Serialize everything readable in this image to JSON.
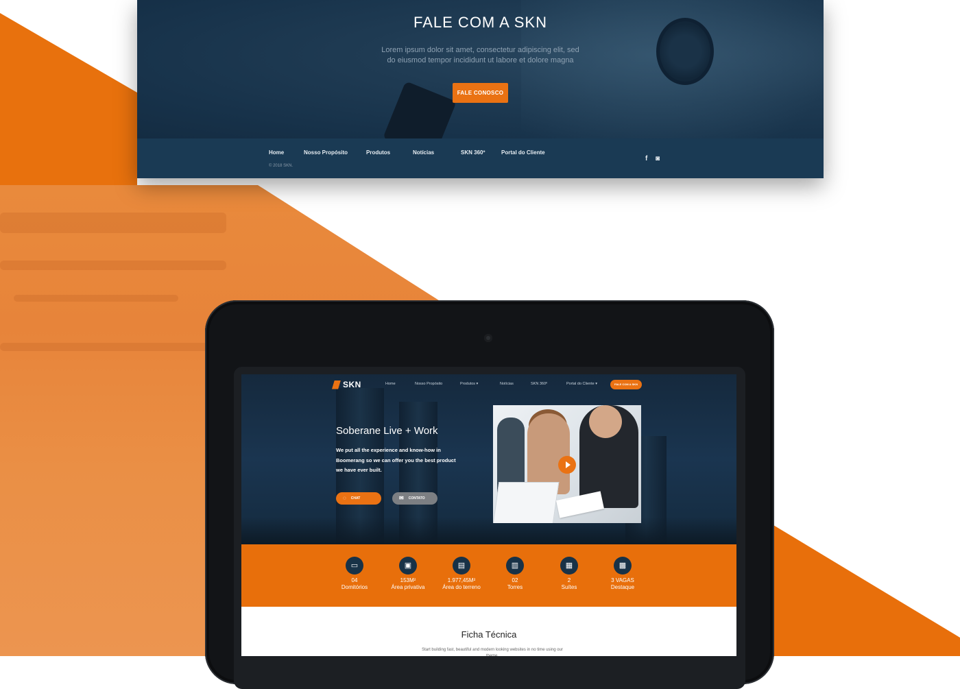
{
  "top_site": {
    "heading": "FALE COM A SKN",
    "lead": "Lorem ipsum dolor sit amet, consectetur adipiscing elit, sed do eiusmod tempor incididunt ut labore et dolore magna",
    "cta_label": "FALE CONOSCO",
    "footer_nav": [
      "Home",
      "Nosso Propósito",
      "Produtos",
      "Notícias",
      "SKN 360º",
      "Portal do Cliente"
    ],
    "copyright": "© 2018 SKN.",
    "social": {
      "facebook": "f",
      "instagram": "◙"
    }
  },
  "tablet_site": {
    "logo": "SKN",
    "nav": [
      "Home",
      "Nosso Propósito",
      "Produtos ▾",
      "Notícias",
      "SKN 360º",
      "Portal do Cliente ▾"
    ],
    "nav_cta": "FALE COM A SKN",
    "hero": {
      "title": "Soberane Live + Work",
      "description": "We put all the experience and know-how in Boomerang so we can offer you the best product we have ever built.",
      "buttons": {
        "chat": "CHAT",
        "contato": "CONTATO"
      }
    },
    "stats": [
      {
        "icon": "bed-icon",
        "glyph": "▭",
        "value": "04",
        "label": "Domitórios"
      },
      {
        "icon": "area-icon",
        "glyph": "▣",
        "value": "153M²",
        "label": "Área privativa"
      },
      {
        "icon": "land-icon",
        "glyph": "▤",
        "value": "1.977,45M²",
        "label": "Área do terreno"
      },
      {
        "icon": "tower-icon",
        "glyph": "▥",
        "value": "02",
        "label": "Torres"
      },
      {
        "icon": "suite-icon",
        "glyph": "▦",
        "value": "2",
        "label": "Suítes"
      },
      {
        "icon": "garage-icon",
        "glyph": "▩",
        "value": "3 VAGAS",
        "label": "Destaque"
      }
    ],
    "ficha": {
      "title": "Ficha Técnica",
      "text": "Start building fast, beautiful and modern looking websites in no time using our theme."
    }
  },
  "colors": {
    "accent_orange": "#e86f0b",
    "navy": "#1a3a54"
  }
}
